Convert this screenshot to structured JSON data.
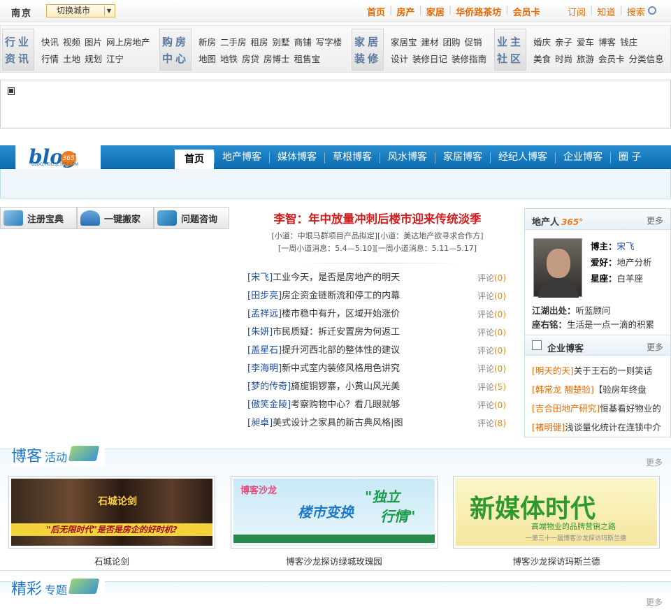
{
  "topbar": {
    "city": "南京",
    "city_switch": "切换城市",
    "nav": [
      "首页",
      "房产",
      "家居",
      "华侨路茶坊",
      "会员卡"
    ],
    "nav2": [
      "订阅",
      "知道",
      "搜索"
    ]
  },
  "categories": [
    {
      "head": [
        "行业",
        "资讯"
      ],
      "row1": [
        "快讯",
        "视频",
        "图片",
        "网上房地产"
      ],
      "row2": [
        "行情",
        "土地",
        "规划",
        "江宁"
      ]
    },
    {
      "head": [
        "购房",
        "中心"
      ],
      "row1": [
        "新房",
        "二手房",
        "租房",
        "别墅",
        "商铺",
        "写字楼"
      ],
      "row2": [
        "地图",
        "地铁",
        "房贷",
        "房博士",
        "租售宝"
      ]
    },
    {
      "head": [
        "家居",
        "装修"
      ],
      "row1": [
        "家居宝",
        "建材",
        "团购",
        "促销"
      ],
      "row2": [
        "设计",
        "装修日记",
        "装修指南"
      ]
    },
    {
      "head": [
        "业主",
        "社区"
      ],
      "row1": [
        "婚庆",
        "亲子",
        "爱车",
        "博客",
        "钱庄"
      ],
      "row2": [
        "美食",
        "时尚",
        "旅游",
        "会员卡",
        "分类信息"
      ]
    }
  ],
  "blog": {
    "logo_sub": "BLOG.HOUSE365.COM",
    "logo_num": "365",
    "nav": [
      "首页",
      "地产博客",
      "媒体博客",
      "草根博客",
      "风水博客",
      "家居博客",
      "经纪人博客",
      "企业博客",
      "圈 子"
    ]
  },
  "buttons": [
    "注册宝典",
    "一键搬家",
    "问题咨询"
  ],
  "headline": "李智：年中放量冲刺后楼市迎来传统淡季",
  "sublines": [
    "[小道：中垠马群项目产品拟定][小道：美达地产欲寻求合作方]",
    "[一周小道消息：5.4—5.10][一周小道消息：5.11—5.17]"
  ],
  "articles": [
    {
      "author": "宋飞",
      "title": "工业今天，是否是房地产的明天",
      "comment_label": "评论",
      "count": "0"
    },
    {
      "author": "田步亮",
      "title": "房企资金链断流和停工的内幕",
      "comment_label": "评论",
      "count": "0"
    },
    {
      "author": "孟祥远",
      "title": "楼市稳中有升，区域开始涨价",
      "comment_label": "评论",
      "count": "0"
    },
    {
      "author": "朱妍",
      "title": "市民质疑：拆迁安置房为何返工",
      "comment_label": "评论",
      "count": "0"
    },
    {
      "author": "盖星石",
      "title": "提升河西北部的整体性的建议",
      "comment_label": "评论",
      "count": "0"
    },
    {
      "author": "李海明",
      "title": "新中式室内装修风格用色讲究",
      "comment_label": "评论",
      "count": "0"
    },
    {
      "author": "梦的传奇",
      "title": "旖旎铜锣寨，小黄山风光美",
      "comment_label": "评论",
      "count": "5"
    },
    {
      "author": "傲笑金陵",
      "title": "考察购物中心？看几眼就够",
      "comment_label": "评论",
      "count": "0"
    },
    {
      "author": "昶卓",
      "title": "美式设计之家具的新古典风格|图",
      "comment_label": "评论",
      "count": "8"
    }
  ],
  "sidebar": {
    "title": "地产人",
    "title_num": "365°",
    "more": "更多",
    "profile": [
      {
        "k": "博主：",
        "v": "宋飞"
      },
      {
        "k": "爱好：",
        "v": "地产分析"
      },
      {
        "k": "星座：",
        "v": "白羊座"
      }
    ],
    "origin_k": "江湖出处：",
    "origin_v": "听蓝顾问",
    "motto_k": "座右铭：",
    "motto_v": "生活是一点一滴的积累",
    "corp_title": "企业博客",
    "corp_more": "更多",
    "corp": [
      {
        "author": "明天的天",
        "title": "关于王石的一则笑话"
      },
      {
        "author": "韩常龙 翘楚验",
        "title": "【验房年终盘"
      },
      {
        "author": "吉合田地产研究",
        "title": "恒基看好物业的"
      },
      {
        "author": "褚明健",
        "title": "浅谈量化统计在连锁中介"
      }
    ]
  },
  "activities": {
    "title_a": "博客",
    "title_b": "活动",
    "more": "更多",
    "cards": [
      {
        "caption": "石城论剑",
        "band": "\"后无限时代\"是否是房企的好时机?",
        "logo": "石城论剑"
      },
      {
        "caption": "博客沙龙探访绿城玫瑰园",
        "tag": "博客沙龙",
        "t1": "楼市变换",
        "t2": "\"独立",
        "t3": "行情\""
      },
      {
        "caption": "博客沙龙探访玛斯兰德",
        "t1": "新媒体时代",
        "t2": "高端物业的品牌营销之路",
        "t3": "一第三十一届博客沙龙探访玛斯兰德"
      }
    ]
  },
  "topics": {
    "title_a": "精彩",
    "title_b": "专题",
    "more": "更多"
  },
  "colors": {
    "accent": "#e46a00",
    "blue": "#0c6db1",
    "red": "#d21e1e"
  }
}
